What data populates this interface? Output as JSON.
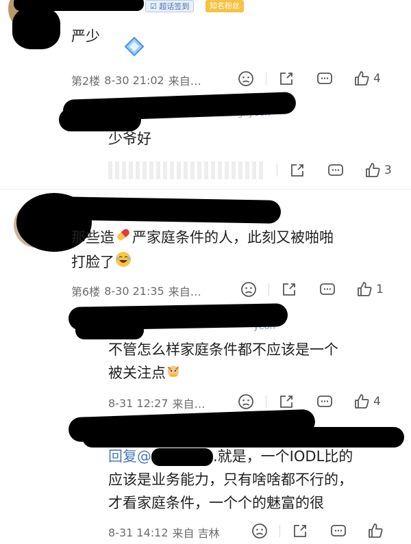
{
  "comments": [
    {
      "badges": {
        "super_checkin": "超话签到",
        "fan": "知名粉丝"
      },
      "text": "严少",
      "floor": "第2楼",
      "date": "8-30 21:02",
      "source": "来自…",
      "like_count": "4"
    },
    {
      "handle_fragment": "eonghyeon",
      "text": "少爷好",
      "like_count": "3"
    },
    {
      "text_before": "那些造",
      "text_after": "严家庭条件的人，此刻又被啪啪",
      "text_line2": "打脸了",
      "floor": "第6楼",
      "date": "8-30 21:35",
      "source": "来自…",
      "like_count": "1"
    },
    {
      "handle_fragment": "yeon",
      "text_line1": "不管怎么样家庭条件都不应该是一个",
      "text_line2": "被关注点",
      "date": "8-31 12:27",
      "source": "来自…",
      "like_count": "4"
    },
    {
      "reply_prefix": "回复@",
      "text_line1_after": ".就是，一个IODL比的",
      "text_line2": "应该是业务能力，只有啥啥都不行的，",
      "text_line3": "才看家庭条件，一个个的魅富的很",
      "date": "8-31 14:12",
      "source": "来自 吉林",
      "like_count": ""
    }
  ],
  "colors": {
    "accent_blue": "#4a90e2",
    "badge_yellow": "#f5c242",
    "meta_gray": "#6b6b6b"
  },
  "icon_names": [
    "dislike-face-icon",
    "share-icon",
    "comment-icon",
    "thumbs-up-icon"
  ]
}
